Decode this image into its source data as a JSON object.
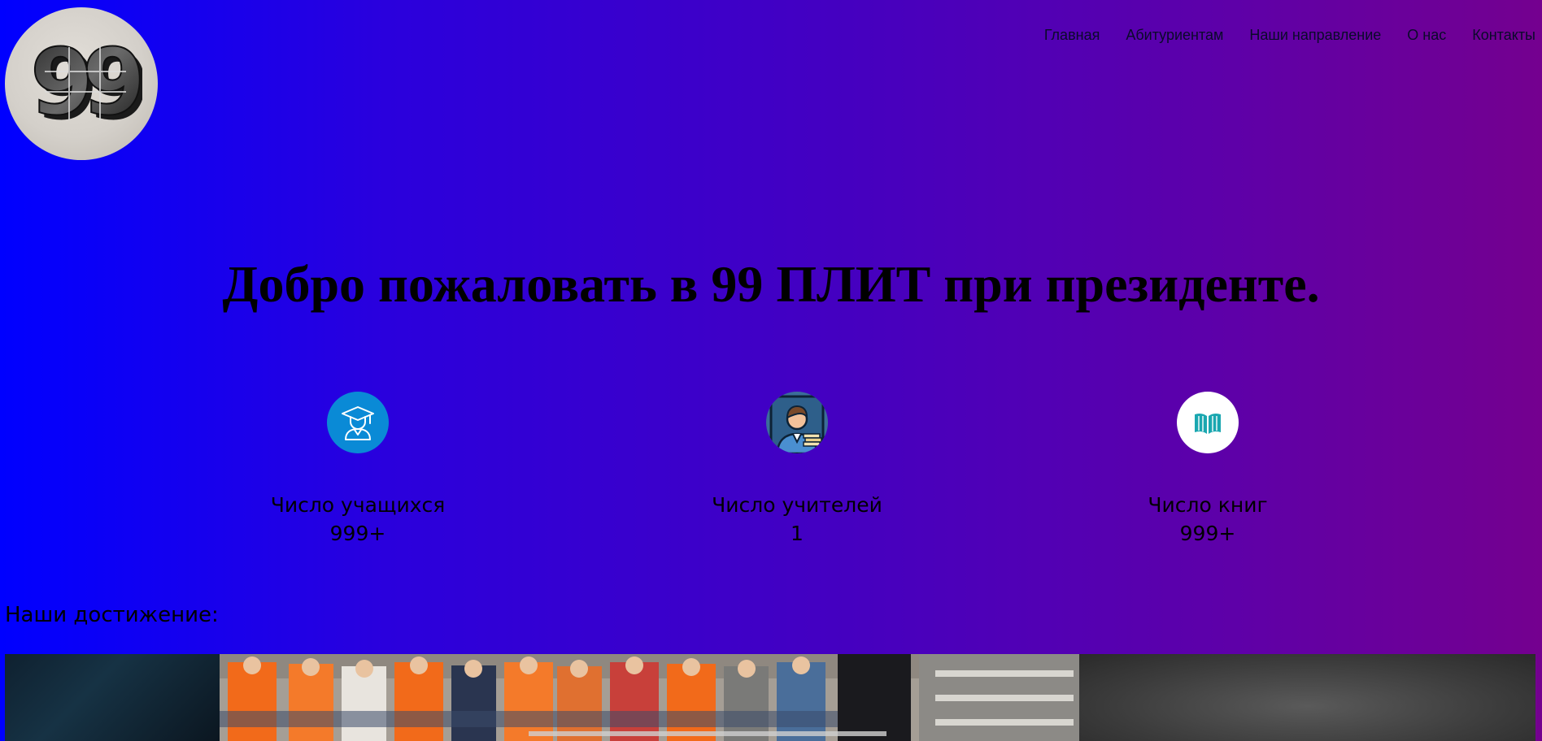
{
  "logo": {
    "text": "99"
  },
  "nav": {
    "items": [
      {
        "label": "Главная"
      },
      {
        "label": "Абитуриентам"
      },
      {
        "label": "Наши направление"
      },
      {
        "label": "О нас"
      },
      {
        "label": "Контакты"
      }
    ]
  },
  "hero": {
    "title": "Добро пожаловать в 99 ПЛИТ при президенте."
  },
  "stats": [
    {
      "icon": "graduate-icon",
      "label": "Число учащихся",
      "value": "999+",
      "color": "#0a8ad6"
    },
    {
      "icon": "teacher-icon",
      "label": "Число учителей",
      "value": "1",
      "color": "#3a6fa0"
    },
    {
      "icon": "book-icon",
      "label": "Число книг",
      "value": "999+",
      "color": "#1aa7b0"
    }
  ],
  "achievements": {
    "heading": "Наши достижение:"
  },
  "colors": {
    "gradient_start": "#0000ff",
    "gradient_end": "#74008f"
  }
}
